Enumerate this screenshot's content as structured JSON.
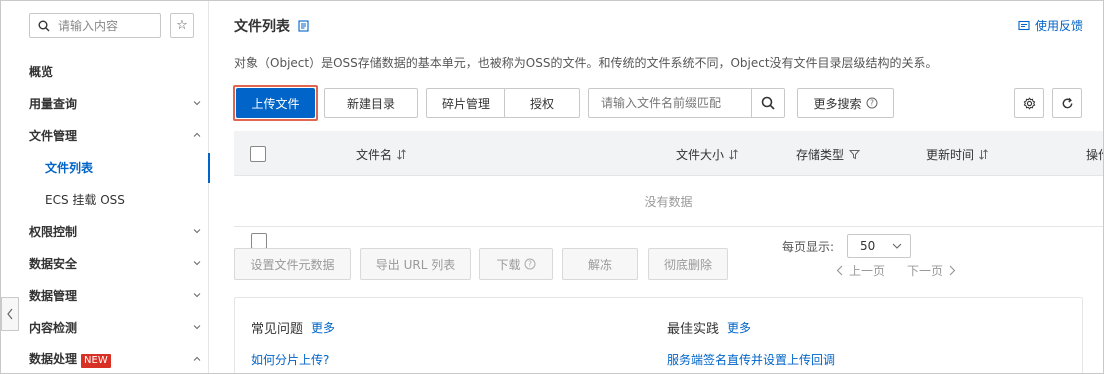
{
  "sidebar": {
    "search_placeholder": "请输入内容",
    "items": [
      {
        "label": "概览"
      },
      {
        "label": "用量查询"
      },
      {
        "label": "文件管理"
      },
      {
        "label": "文件列表"
      },
      {
        "label": "ECS 挂载 OSS"
      },
      {
        "label": "权限控制"
      },
      {
        "label": "数据安全"
      },
      {
        "label": "数据管理"
      },
      {
        "label": "内容检测"
      },
      {
        "label": "数据处理",
        "badge": "NEW"
      }
    ]
  },
  "header": {
    "title": "文件列表",
    "feedback": "使用反馈",
    "description": "对象（Object）是OSS存储数据的基本单元，也被称为OSS的文件。和传统的文件系统不同，Object没有文件目录层级结构的关系。"
  },
  "toolbar": {
    "upload": "上传文件",
    "new_dir": "新建目录",
    "fragments": "碎片管理",
    "authorize": "授权",
    "search_placeholder": "请输入文件名前缀匹配",
    "more_search": "更多搜索"
  },
  "table": {
    "columns": [
      "文件名",
      "文件大小",
      "存储类型",
      "更新时间",
      "操作"
    ],
    "empty_text": "没有数据"
  },
  "bulk_actions": {
    "set_meta": "设置文件元数据",
    "export_url": "导出 URL 列表",
    "download": "下载",
    "unfreeze": "解冻",
    "delete": "彻底删除"
  },
  "pagination": {
    "page_size_label": "每页显示:",
    "page_size": "50",
    "prev": "上一页",
    "next": "下一页"
  },
  "help": {
    "faq_title": "常见问题",
    "faq_more": "更多",
    "faq_link": "如何分片上传?",
    "practice_title": "最佳实践",
    "practice_more": "更多",
    "practice_link": "服务端签名直传并设置上传回调"
  },
  "colors": {
    "primary": "#0064c8",
    "highlight": "#e2664e",
    "badge": "#d93026"
  }
}
